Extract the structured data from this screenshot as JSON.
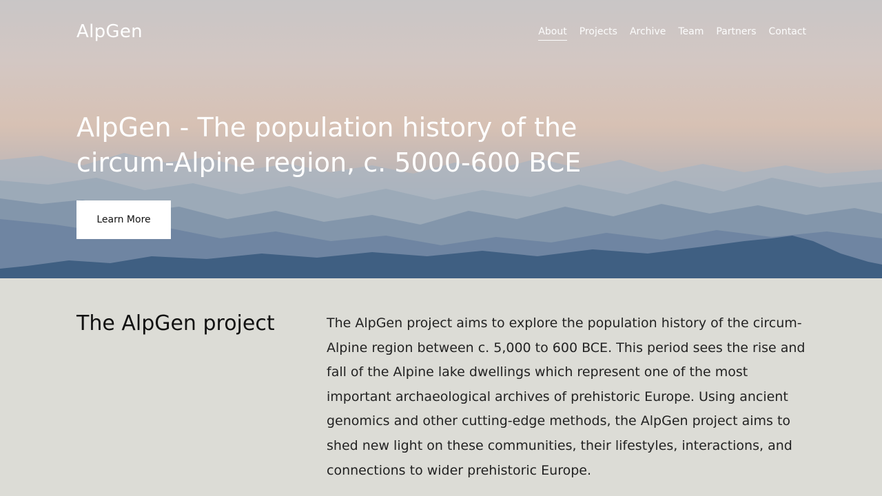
{
  "header": {
    "logo": "AlpGen",
    "nav": [
      {
        "label": "About",
        "active": true
      },
      {
        "label": "Projects",
        "active": false
      },
      {
        "label": "Archive",
        "active": false
      },
      {
        "label": "Team",
        "active": false
      },
      {
        "label": "Partners",
        "active": false
      },
      {
        "label": "Contact",
        "active": false
      }
    ]
  },
  "hero": {
    "title": "AlpGen - The population history of the circum-Alpine region, c. 5000-600 BCE",
    "cta_label": "Learn More"
  },
  "project": {
    "heading": "The AlpGen project",
    "body": "The AlpGen project aims to explore the population history of the circum-Alpine region between c. 5,000 to 600 BCE. This period sees the rise and fall of the Alpine lake dwellings which represent one of the most important archaeological archives of prehistoric Europe. Using ancient genomics and other cutting-edge methods, the AlpGen project aims to shed new light on these communities, their lifestyles, interactions, and connections to wider prehistoric Europe."
  },
  "colors": {
    "section_bg": "#dcdcd6",
    "cta_bg": "#ffffff",
    "text_light": "#ffffff",
    "text_dark": "#111111"
  }
}
